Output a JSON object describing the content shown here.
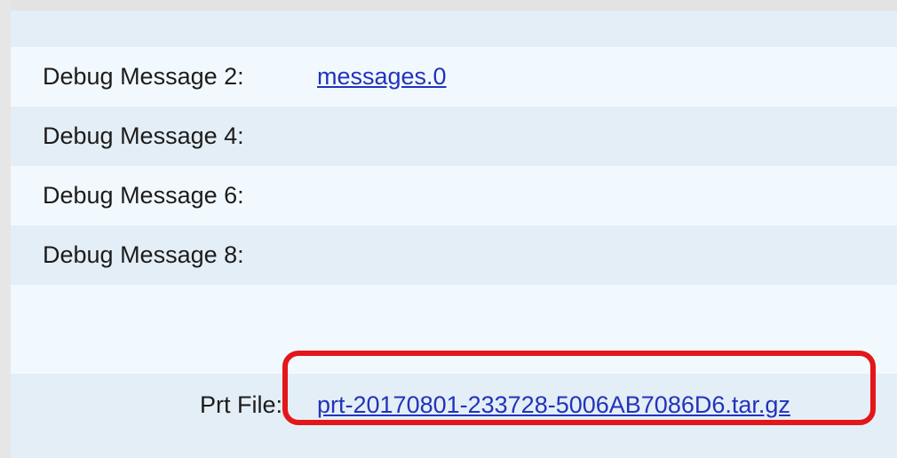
{
  "debug_rows": [
    {
      "label": "Debug Message 2:",
      "value": "messages.0"
    },
    {
      "label": "Debug Message 4:",
      "value": ""
    },
    {
      "label": "Debug Message 6:",
      "value": ""
    },
    {
      "label": "Debug Message 8:",
      "value": ""
    }
  ],
  "prt_file": {
    "label": "Prt File:",
    "value": "prt-20170801-233728-5006AB7086D6.tar.gz"
  },
  "colors": {
    "link": "#2233bb",
    "highlight": "#e3161a",
    "row_light": "#f2f9fe",
    "row_dark": "#e4eef6"
  }
}
